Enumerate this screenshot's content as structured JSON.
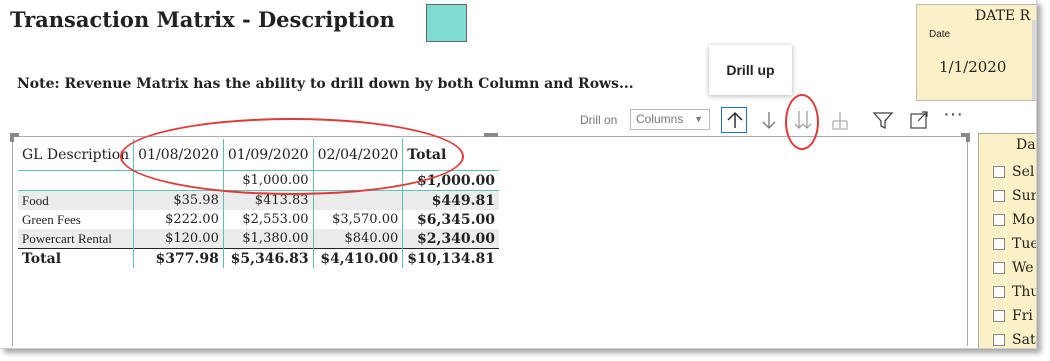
{
  "page": {
    "title": "Transaction Matrix - Description",
    "note": "Note: Revenue Matrix has the ability to drill down by both Column and Rows...",
    "swatch_color": "#7fdcd3"
  },
  "tooltip": {
    "text": "Drill up"
  },
  "date_slicer": {
    "title": "DATE R",
    "label": "Date",
    "value": "1/1/2020"
  },
  "toolbar": {
    "drill_on_label": "Drill on",
    "drill_on_value": "Columns",
    "buttons": [
      {
        "name": "drill-up",
        "icon": "arrow-up-icon"
      },
      {
        "name": "drill-down",
        "icon": "arrow-down-icon"
      },
      {
        "name": "expand-next-level",
        "icon": "double-arrow-down-icon"
      },
      {
        "name": "expand-all",
        "icon": "fork-down-icon"
      },
      {
        "name": "filter",
        "icon": "filter-icon"
      },
      {
        "name": "focus-mode",
        "icon": "focus-icon"
      },
      {
        "name": "more-options",
        "icon": "ellipsis-icon",
        "label": "···"
      }
    ]
  },
  "matrix": {
    "headers": [
      "GL Description",
      "01/08/2020",
      "01/09/2020",
      "02/04/2020",
      "Total"
    ],
    "rows": [
      {
        "label": "",
        "cells": [
          "",
          "$1,000.00",
          ""
        ],
        "total": "$1,000.00"
      },
      {
        "label": "Food",
        "cells": [
          "$35.98",
          "$413.83",
          ""
        ],
        "total": "$449.81"
      },
      {
        "label": "Green Fees",
        "cells": [
          "$222.00",
          "$2,553.00",
          "$3,570.00"
        ],
        "total": "$6,345.00"
      },
      {
        "label": "Powercart Rental",
        "cells": [
          "$120.00",
          "$1,380.00",
          "$840.00"
        ],
        "total": "$2,340.00"
      }
    ],
    "grand_total": {
      "label": "Total",
      "cells": [
        "$377.98",
        "$5,346.83",
        "$4,410.00"
      ],
      "total": "$10,134.81"
    }
  },
  "day_slicer": {
    "title": "Da",
    "items": [
      "Sel",
      "Sur",
      "Mo",
      "Tue",
      "We",
      "Thu",
      "Fri",
      "Sat"
    ]
  },
  "colors": {
    "highlight_ring": "#e23a3a",
    "slicer_bg": "#fbf0c6",
    "grid_line": "#5fc0b8",
    "drill_up_border": "#1a73c8"
  }
}
